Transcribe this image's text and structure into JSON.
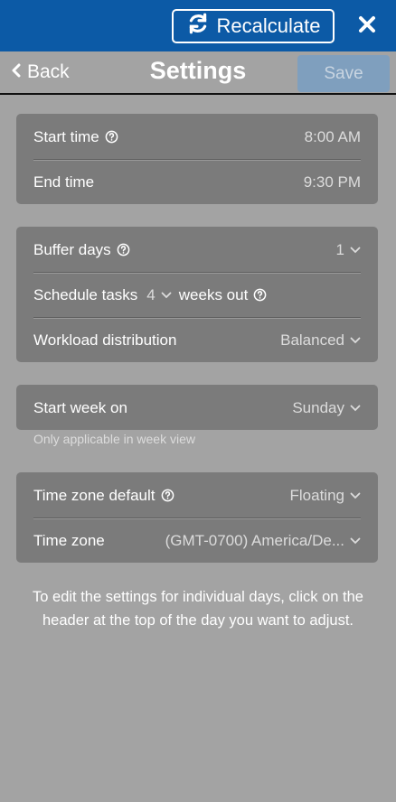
{
  "topbar": {
    "recalculate_label": "Recalculate",
    "recalculate_icon": "refresh-icon",
    "close_icon": "close-icon",
    "background": "#0c5aa6"
  },
  "header": {
    "back_label": "Back",
    "title": "Settings",
    "save_label": "Save"
  },
  "time_card": {
    "start_time_label": "Start time",
    "start_time_value": "8:00 AM",
    "end_time_label": "End time",
    "end_time_value": "9:30 PM"
  },
  "schedule_card": {
    "buffer_days_label": "Buffer days",
    "buffer_days_value": "1",
    "schedule_tasks_label": "Schedule tasks",
    "schedule_tasks_value": "4",
    "weeks_out_label": "weeks out",
    "workload_label": "Workload distribution",
    "workload_value": "Balanced"
  },
  "week_card": {
    "start_week_label": "Start week on",
    "start_week_value": "Sunday",
    "hint": "Only applicable in week view"
  },
  "timezone_card": {
    "tz_default_label": "Time zone default",
    "tz_default_value": "Floating",
    "tz_label": "Time zone",
    "tz_value": "(GMT-0700) America/De..."
  },
  "footer_note": "To edit the settings for individual days, click on the header at the top of the day you want to adjust."
}
